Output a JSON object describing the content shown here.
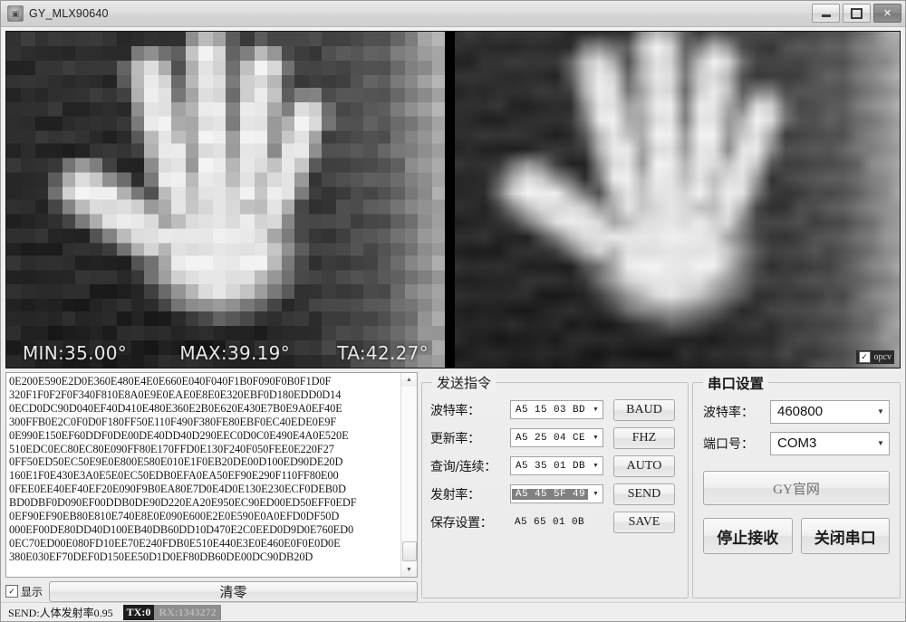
{
  "window": {
    "title": "GY_MLX90640",
    "icon": "app-icon",
    "controls": {
      "minimize": "–",
      "maximize": "□",
      "close": "✕"
    }
  },
  "thermal": {
    "overlay": {
      "min": "MIN:35.00°",
      "max": "MAX:39.19°",
      "ta": "TA:42.27°"
    },
    "opcv": {
      "label": "opcv",
      "checked": true,
      "mark": "✓"
    }
  },
  "log": {
    "lines": [
      "0E200E590E2D0E360E480E4E0E660E040F040F1B0F090F0B0F1D0F",
      "320F1F0F2F0F340F810E8A0E9E0EAE0E8E0E320EBF0D180EDD0D14",
      "0ECD0DC90D040EF40D410E480E360E2B0E620E430E7B0E9A0EF40E",
      "300FFB0E2C0F0D0F180FF50E110F490F380FE80EBF0EC40EDE0E9F",
      "0E990E150EF60DDF0DE00DE40DD40D290EEC0D0C0E490E4A0E520E",
      "510EDC0EC80EC80E090FF80E170FFD0E130F240F050FEE0E220F27",
      "0FF50ED50EC50E9E0E800E580E010E1F0EB20DE00D100ED90DE20D",
      "160E1F0E430E3A0E5E0EC50EDB0EFA0EA50EF90E290F110FF80E00",
      "0FEE0EE40EF40EF20E090F9B0EA80E7D0E4D0E130E230ECF0DEB0D",
      "BD0DBF0D090EF00DDB0DE90D220EA20E950EC90ED00ED50EFF0EDF",
      "0EF90EF90EB80E810E740E8E0E090E600E2E0E590E0A0EFD0DF50D",
      "000EF00DE80DD40D100EB40DB60DD10D470E2C0EED0D9D0E760ED0",
      "0EC70ED00E080FD10EE70E240FDB0E510E440E3E0E460E0F0E0D0E",
      "380E030EF70DEF0D150EE50D1D0EF80DB60DE00DC90DB20D"
    ],
    "scroll": {
      "up_arrow": "▲",
      "down_arrow": "▼"
    },
    "show_checkbox": {
      "label": "显示",
      "checked": true,
      "mark": "✓"
    },
    "clear_button": "清零"
  },
  "send_group": {
    "title": "发送指令",
    "rows": [
      {
        "label": "波特率：",
        "value": "A5 15 03 BD",
        "button": "BAUD",
        "type": "combo",
        "selected": false
      },
      {
        "label": "更新率：",
        "value": "A5 25 04 CE",
        "button": "FHZ",
        "type": "combo",
        "selected": false
      },
      {
        "label": "查询/连续：",
        "value": "A5 35 01 DB",
        "button": "AUTO",
        "type": "combo",
        "selected": false
      },
      {
        "label": "发射率：",
        "value": "A5 45 5F 49",
        "button": "SEND",
        "type": "combo",
        "selected": true
      },
      {
        "label": "保存设置：",
        "value": "A5 65 01 0B",
        "button": "SAVE",
        "type": "static",
        "selected": false
      }
    ],
    "dropdown_arrow": "▼"
  },
  "port_group": {
    "title": "串口设置",
    "baud_label": "波特率：",
    "baud_value": "460800",
    "port_label": "端口号：",
    "port_value": "COM3",
    "dropdown_arrow": "▼",
    "website_button": "GY官网",
    "stop_button": "停止接收",
    "close_button": "关闭串口"
  },
  "status": {
    "send_text": "SEND:人体发射率0.95",
    "tx": "TX:0",
    "rx": "RX:1343272"
  },
  "colors": {
    "window_bg": "#f0f0f0",
    "titlebar": "#dedede",
    "image_bg": "#000000",
    "text": "#1a1a1a",
    "badge_tx_bg": "#1d1d1d",
    "badge_rx_bg": "#8d8d8d"
  }
}
